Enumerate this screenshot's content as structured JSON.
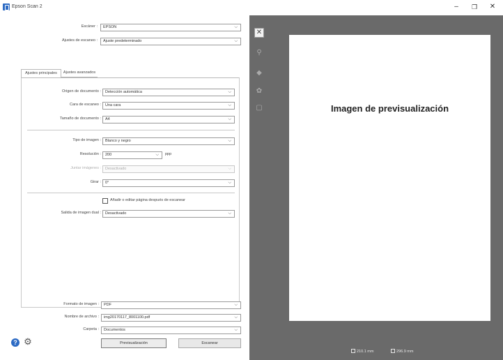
{
  "window": {
    "title": "Epson Scan 2",
    "minimize": "–",
    "maximize": "❐",
    "close": "✕"
  },
  "top": {
    "scanner_label": "Escáner :",
    "scanner_value": "EPSON",
    "settings_label": "Ajustes de escaneo :",
    "settings_value": "Ajuste predeterminado"
  },
  "tabs": [
    "Ajustes principales",
    "Ajustes avanzados"
  ],
  "main": {
    "source_label": "Origen de documento :",
    "source_value": "Detección automática",
    "side_label": "Cara de escaneo :",
    "side_value": "Una cara",
    "size_label": "Tamaño de documento :",
    "size_value": "A4",
    "image_type_label": "Tipo de imagen :",
    "image_type_value": "Blanco y negro",
    "resolution_label": "Resolución :",
    "resolution_value": "200",
    "resolution_unit": "ppp",
    "stitch_label": "Juntar imágenes :",
    "stitch_value": "Desactivado",
    "rotate_label": "Girar :",
    "rotate_value": "0°",
    "add_edit_label": "Añadir o editar página después de escanear",
    "dual_output_label": "Salida de imagen dual :",
    "dual_output_value": "Desactivado"
  },
  "bottom": {
    "format_label": "Formato de imagen :",
    "format_value": "PDF",
    "filename_label": "Nombre de archivo :",
    "filename_value": "img20170117_8001100.pdf",
    "folder_label": "Carpeta :",
    "folder_value": "Documentos",
    "preview_button": "Previsualización",
    "scan_button": "Escanear"
  },
  "icons": {
    "chevron": "⌵",
    "help": "?",
    "gear": "⚙",
    "close_tool": "✕",
    "zoom_tool": "⚲",
    "rotate_tool": "◆",
    "settings_tool": "✿",
    "select_tool": "▢"
  },
  "preview": {
    "text": "Imagen de previsualización",
    "width": "210.1 mm",
    "height": "296.9 mm"
  }
}
